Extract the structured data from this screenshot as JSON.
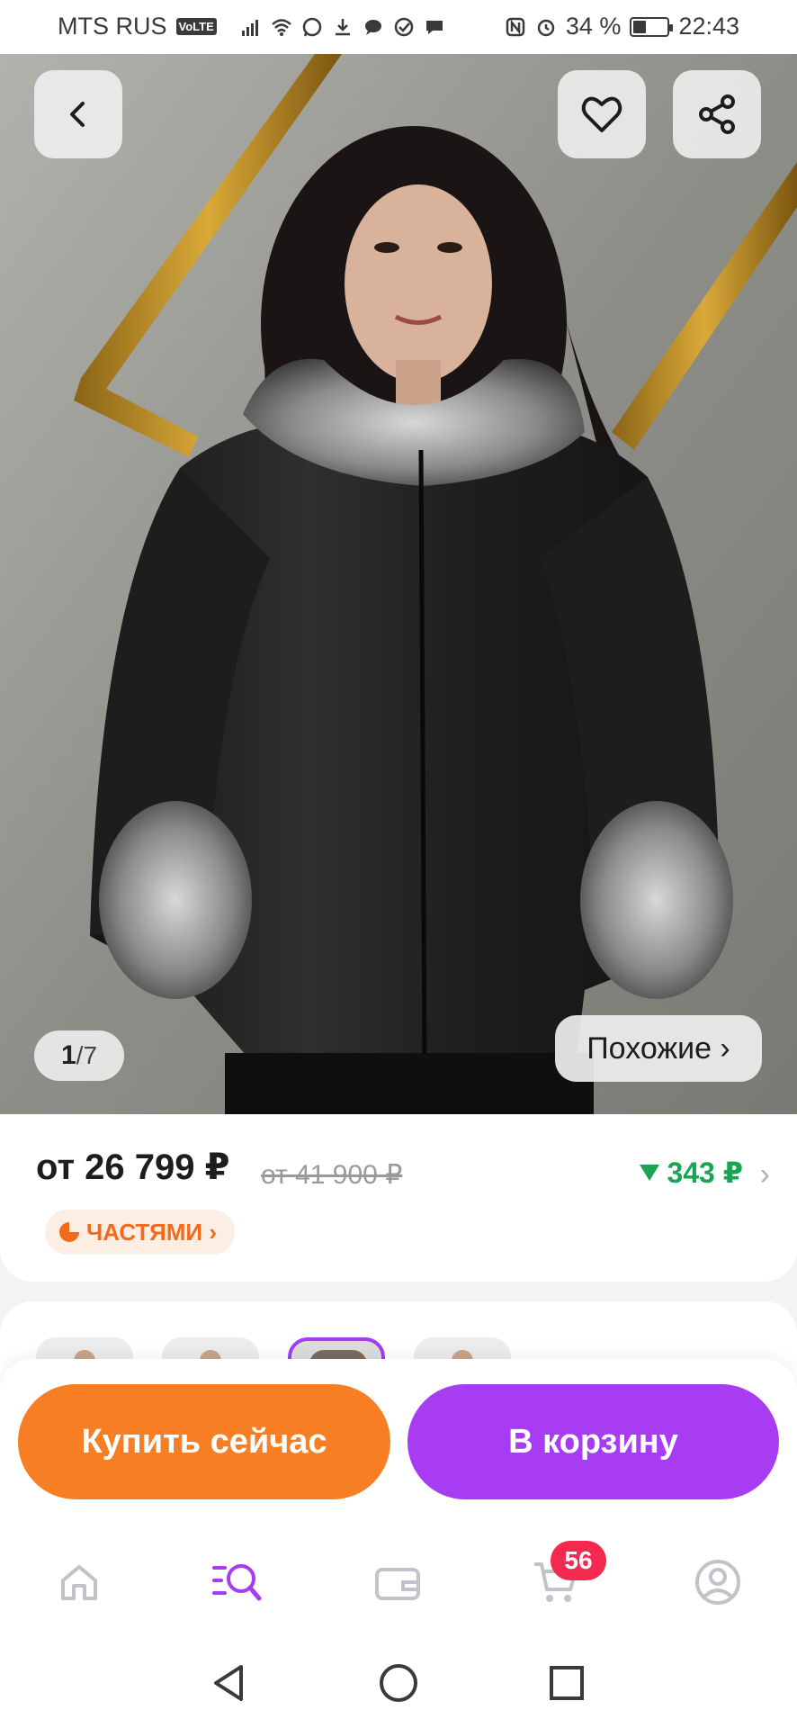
{
  "status_bar": {
    "carrier": "MTS RUS",
    "network_badge": "VoLTE",
    "left_icons": [
      "signal-icon",
      "wifi-icon",
      "whatsapp-icon",
      "download-icon",
      "chat-icon",
      "check-circle-icon",
      "message-icon"
    ],
    "right_icons": [
      "nfc-icon",
      "alarm-icon"
    ],
    "battery": "34 %",
    "battery_level": 0.34,
    "time": "22:43"
  },
  "gallery": {
    "current": "1",
    "total": "7",
    "similar_label": "Похожие ›",
    "image_subject": "model-photo"
  },
  "header_actions": {
    "back_icon": "chevron-left-icon",
    "favorite_icon": "heart-icon",
    "share_icon": "share-icon"
  },
  "product": {
    "price": "от 26 799 ₽",
    "old_price": "от 41 900 ₽",
    "bonus": "343 ₽",
    "installments": "ЧАСТЯМИ ›"
  },
  "actions": {
    "buy_now": "Купить сейчас",
    "add_to_cart": "В корзину"
  },
  "bottom_nav": {
    "items": [
      {
        "icon": "home-icon",
        "active": false
      },
      {
        "icon": "catalog-search-icon",
        "active": true
      },
      {
        "icon": "wallet-icon",
        "active": false
      },
      {
        "icon": "cart-icon",
        "active": false
      },
      {
        "icon": "profile-icon",
        "active": false
      }
    ],
    "cart_badge": "56"
  },
  "colors": {
    "accent_purple": "#a73cf2",
    "accent_orange": "#f77e22",
    "bonus_green": "#1aa552",
    "badge_red": "#f32950"
  }
}
